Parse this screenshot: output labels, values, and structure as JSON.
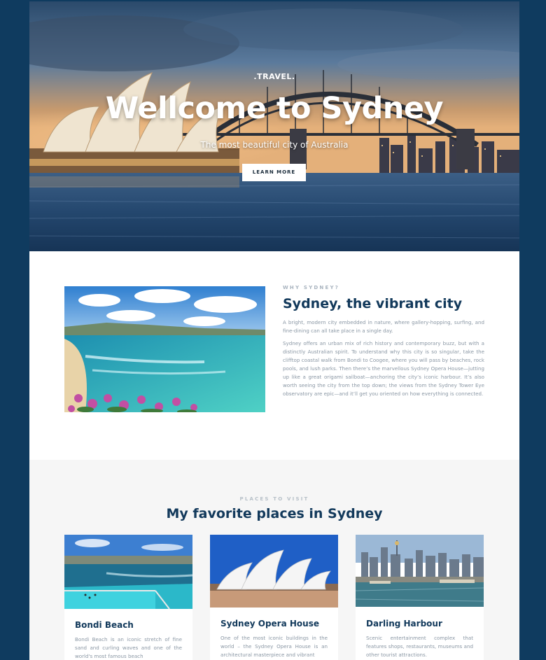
{
  "hero": {
    "kicker": ".TRAVEL.",
    "title": "Wellcome to Sydney",
    "subtitle": "The most beautiful city of Australia",
    "button_label": "LEARN MORE"
  },
  "about": {
    "kicker": "WHY SYDNEY?",
    "title": "Sydney, the vibrant city",
    "paragraph1": "A bright, modern city embedded in nature, where gallery-hopping, surfing, and fine-dining can all take place in a single day.",
    "paragraph2": "Sydney offers an urban mix of rich history and contemporary buzz, but with a distinctly Australian spirit. To understand why this city is so singular, take the clifftop coastal walk from Bondi to Coogee, where you will pass by beaches, rock pools, and lush parks. Then there’s the marvellous Sydney Opera House—jutting up like a great origami sailboat—anchoring the city’s iconic harbour. It’s also worth seeing the city from the top down; the views from the Sydney Tower Eye observatory are epic—and it’ll get you oriented on how everything is connected."
  },
  "places": {
    "kicker": "PLACES TO VISIT",
    "title": "My favorite places in Sydney",
    "cards": [
      {
        "name": "Bondi Beach",
        "description": "Bondi Beach is an iconic stretch of fine sand and curling waves and one of the world's most famous beach"
      },
      {
        "name": "Sydney Opera House",
        "description": "One of the most iconic buildings in the world – the Sydney Opera House is an architectural masterpiece and vibrant"
      },
      {
        "name": "Darling Harbour",
        "description": "Scenic entertainment complex that features shops, restaurants, museums and other tourist attractions."
      }
    ]
  },
  "colors": {
    "page_background": "#0f3b5f",
    "heading": "#12395b",
    "body_text": "#8a97a4",
    "section_alt_background": "#f6f6f6"
  }
}
